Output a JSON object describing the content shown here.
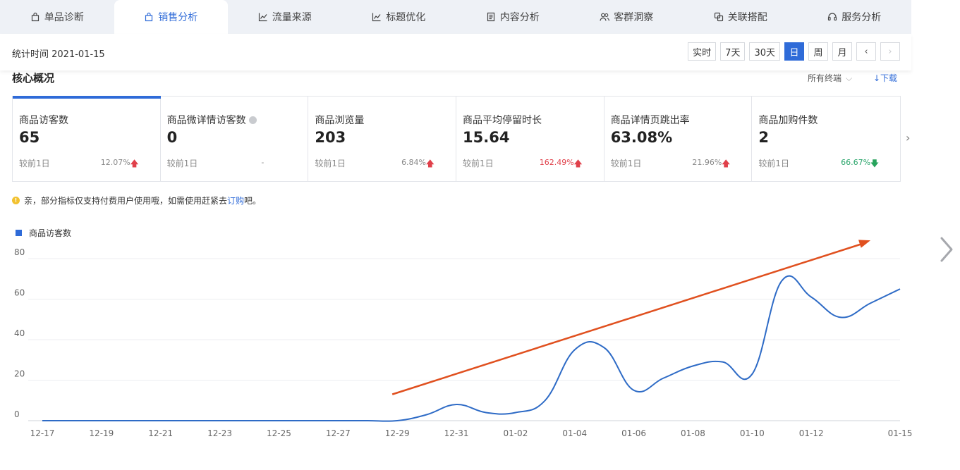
{
  "tabs": [
    {
      "label": "单品诊断",
      "icon": "bag-icon"
    },
    {
      "label": "销售分析",
      "icon": "bag-icon",
      "active": true
    },
    {
      "label": "流量来源",
      "icon": "line-chart-icon"
    },
    {
      "label": "标题优化",
      "icon": "line-chart-icon"
    },
    {
      "label": "内容分析",
      "icon": "document-icon"
    },
    {
      "label": "客群洞察",
      "icon": "users-icon"
    },
    {
      "label": "关联搭配",
      "icon": "link-icon"
    },
    {
      "label": "服务分析",
      "icon": "headset-icon"
    }
  ],
  "stat_time": "统计时间 2021-01-15",
  "range_buttons": [
    "实时",
    "7天",
    "30天",
    "日",
    "周",
    "月"
  ],
  "range_active": "日",
  "core": {
    "title": "核心概况",
    "terminal": "所有终端",
    "download": "↓下载"
  },
  "metrics": [
    {
      "label": "商品访客数",
      "value": "65",
      "compare": "较前1日",
      "change": "12.07%",
      "direction": "up",
      "active": true
    },
    {
      "label": "商品微详情访客数",
      "value": "0",
      "compare": "较前1日",
      "change": "-",
      "direction": "none",
      "info": true
    },
    {
      "label": "商品浏览量",
      "value": "203",
      "compare": "较前1日",
      "change": "6.84%",
      "direction": "up"
    },
    {
      "label": "商品平均停留时长",
      "value": "15.64",
      "compare": "较前1日",
      "change": "162.49%",
      "direction": "up",
      "highlight": "red"
    },
    {
      "label": "商品详情页跳出率",
      "value": "63.08%",
      "compare": "较前1日",
      "change": "21.96%",
      "direction": "up"
    },
    {
      "label": "商品加购件数",
      "value": "2",
      "compare": "较前1日",
      "change": "66.67%",
      "direction": "down",
      "highlight": "green"
    }
  ],
  "notice": {
    "text_before": "亲，部分指标仅支持付费用户使用哦，如需使用赶紧去 ",
    "link": "订购",
    "text_after": "吧。"
  },
  "colors": {
    "accent": "#2f6bd8",
    "line": "#2e6bc6",
    "annotation_arrow": "#e0501f",
    "up": "#e0404a",
    "down": "#27a35c"
  },
  "chart_data": {
    "type": "line",
    "legend": [
      "商品访客数"
    ],
    "x": [
      "12-17",
      "12-18",
      "12-19",
      "12-20",
      "12-21",
      "12-22",
      "12-23",
      "12-24",
      "12-25",
      "12-26",
      "12-27",
      "12-28",
      "12-29",
      "12-30",
      "12-31",
      "01-01",
      "01-02",
      "01-03",
      "01-04",
      "01-05",
      "01-06",
      "01-07",
      "01-08",
      "01-09",
      "01-10",
      "01-11",
      "01-12",
      "01-13",
      "01-14",
      "01-15"
    ],
    "x_tick_labels": [
      "12-17",
      "12-19",
      "12-21",
      "12-23",
      "12-25",
      "12-27",
      "12-29",
      "12-31",
      "01-02",
      "01-04",
      "01-06",
      "01-08",
      "01-10",
      "01-12",
      "01-15"
    ],
    "series": [
      {
        "name": "商品访客数",
        "values": [
          0,
          0,
          0,
          0,
          0,
          0,
          0,
          0,
          0,
          0,
          0,
          0,
          0,
          3,
          8,
          4,
          4,
          10,
          35,
          36,
          15,
          21,
          27,
          29,
          23,
          69,
          61,
          51,
          58,
          65
        ]
      }
    ],
    "ylim": [
      0,
      80
    ],
    "y_ticks": [
      0,
      20,
      40,
      60,
      80
    ],
    "grid": true,
    "annotation": {
      "type": "trend-arrow",
      "from": [
        "12-29",
        13
      ],
      "to": [
        "01-14",
        89
      ]
    }
  }
}
